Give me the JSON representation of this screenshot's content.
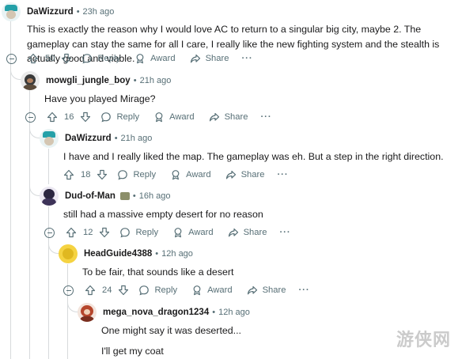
{
  "comments": [
    {
      "author": "DaWizzurd",
      "time": "23h ago",
      "body": "This is exactly the reason why I would love AC to return to a singular big city, maybe 2. The gameplay can stay the same for all I care, I really like the new fighting system and the stealth is actually good and viable.",
      "votes": "50",
      "reply_label": "Reply",
      "award_label": "Award",
      "share_label": "Share",
      "more_label": "···"
    },
    {
      "author": "mowgli_jungle_boy",
      "time": "21h ago",
      "body": "Have you played Mirage?",
      "votes": "16",
      "reply_label": "Reply",
      "award_label": "Award",
      "share_label": "Share",
      "more_label": "···"
    },
    {
      "author": "DaWizzurd",
      "time": "21h ago",
      "body": "I have and I really liked the map. The gameplay was eh. But a step in the right direction.",
      "votes": "18",
      "reply_label": "Reply",
      "award_label": "Award",
      "share_label": "Share",
      "more_label": "···"
    },
    {
      "author": "Dud-of-Man",
      "time": "16h ago",
      "body": "still had a massive empty desert for no reason",
      "votes": "12",
      "reply_label": "Reply",
      "award_label": "Award",
      "share_label": "Share",
      "more_label": "···"
    },
    {
      "author": "HeadGuide4388",
      "time": "12h ago",
      "body": "To be fair, that sounds like a desert",
      "votes": "24",
      "reply_label": "Reply",
      "award_label": "Award",
      "share_label": "Share",
      "more_label": "···"
    },
    {
      "author": "mega_nova_dragon1234",
      "time": "12h ago",
      "body": "One might say it was deserted...",
      "body2": "I'll get my coat"
    }
  ],
  "separator": "•",
  "watermark": "游侠网",
  "colors": {
    "meta": "#576f76",
    "line": "#d7dadc",
    "text": "#1a1a1b"
  }
}
